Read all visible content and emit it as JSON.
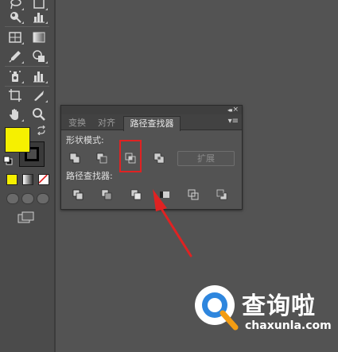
{
  "toolbar": {
    "tools": [
      {
        "name": "lasso-tool",
        "icon": "lasso-icon"
      },
      {
        "name": "blend-tool",
        "icon": "blend-icon"
      },
      {
        "name": "warp-tool",
        "icon": "warp-icon"
      },
      {
        "name": "graph-tool",
        "icon": "graph-icon"
      },
      {
        "name": "mesh-tool",
        "icon": "mesh-icon"
      },
      {
        "name": "gradient-tool",
        "icon": "gradient-icon"
      },
      {
        "name": "eyedropper-tool",
        "icon": "eyedropper-icon"
      },
      {
        "name": "shape-builder-tool",
        "icon": "shape-builder-icon"
      },
      {
        "name": "symbol-sprayer-tool",
        "icon": "symbol-sprayer-icon"
      },
      {
        "name": "column-graph-tool",
        "icon": "column-graph-icon"
      },
      {
        "name": "artboard-tool",
        "icon": "artboard-icon"
      },
      {
        "name": "slice-tool",
        "icon": "slice-icon"
      },
      {
        "name": "hand-tool",
        "icon": "hand-icon"
      },
      {
        "name": "zoom-tool",
        "icon": "zoom-icon"
      }
    ],
    "fill_color": "#f6f000",
    "stroke_color": "#000000"
  },
  "panel": {
    "tabs": [
      {
        "label": "变换"
      },
      {
        "label": "对齐"
      },
      {
        "label": "路径查找器"
      }
    ],
    "active_tab": "路径查找器",
    "shape_modes_label": "形状模式:",
    "pathfinders_label": "路径查找器:",
    "expand_label": "扩展",
    "shape_mode_buttons": [
      "unite-icon",
      "minus-front-icon",
      "intersect-icon",
      "exclude-icon"
    ],
    "pathfinder_buttons": [
      "divide-icon",
      "trim-icon",
      "merge-icon",
      "crop-icon",
      "outline-icon",
      "minus-back-icon"
    ]
  },
  "annotation": {
    "highlight_color": "#e02222"
  },
  "watermark": {
    "brand": "查询啦",
    "url": "chaxunla.com"
  }
}
